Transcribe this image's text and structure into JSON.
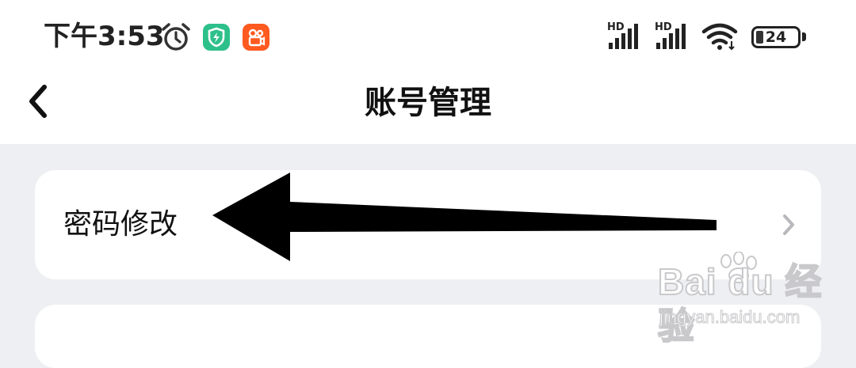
{
  "status_bar": {
    "time": "下午3:53",
    "signal_1_label": "HD",
    "signal_2_label": "HD",
    "battery_level": "24",
    "icons": [
      "alarm-icon",
      "shield-app-icon",
      "kuaishou-app-icon",
      "signal-icon",
      "wifi-icon",
      "battery-icon"
    ]
  },
  "nav": {
    "title": "账号管理",
    "back_icon": "chevron-left-icon"
  },
  "menu": {
    "items": [
      {
        "label": "密码修改",
        "icon": "chevron-right-icon"
      }
    ]
  },
  "annotation": {
    "arrow_direction": "left",
    "color": "#000000"
  },
  "watermark": {
    "brand": "Bai du 经验",
    "url": "jingyan.baidu.com"
  },
  "colors": {
    "background": "#eeeff2",
    "card": "#ffffff",
    "shield_app": "#2dc08a",
    "kuaishou_app": "#ff5a1f"
  }
}
